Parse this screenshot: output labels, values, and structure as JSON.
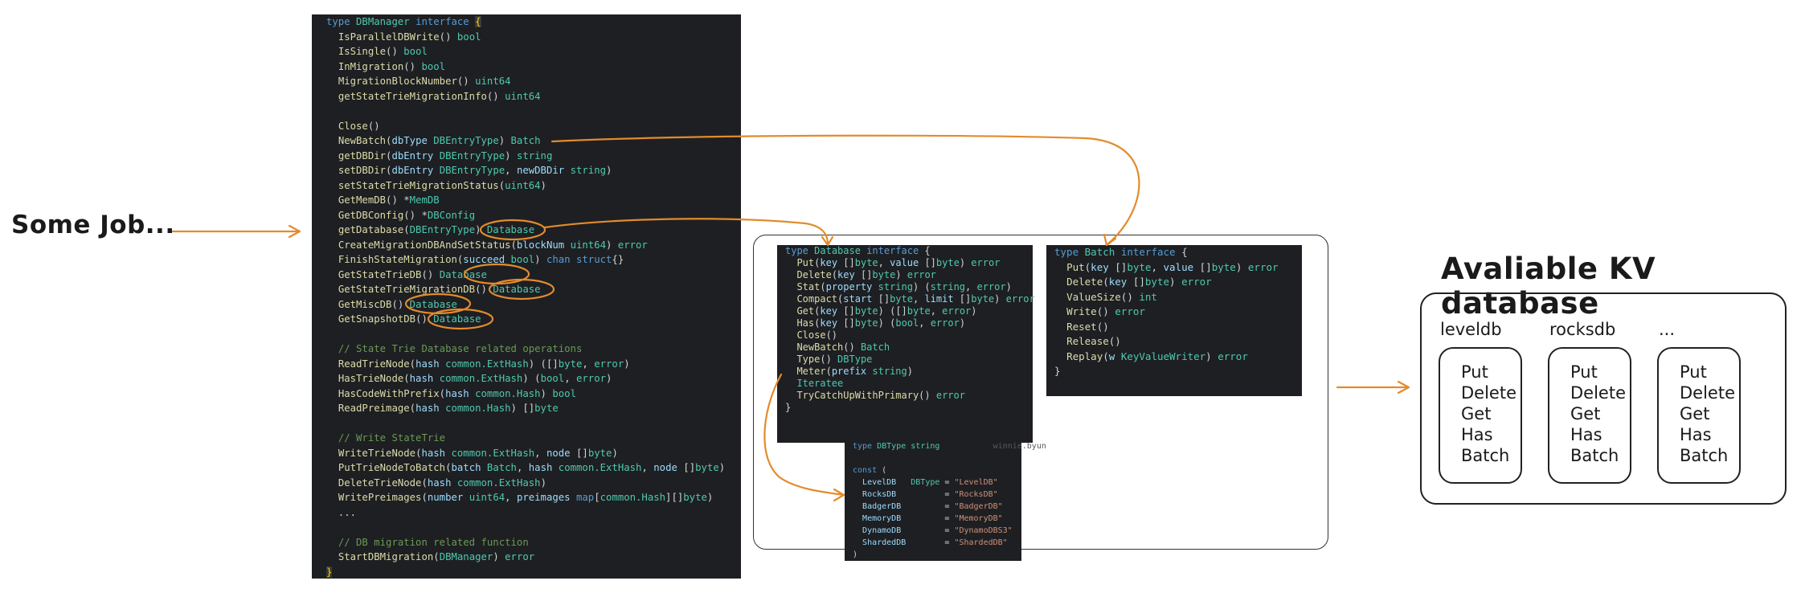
{
  "job_label": "Some Job...",
  "kv_title": "Avaliable KV database",
  "kv_columns": [
    {
      "name": "leveldb",
      "ops": [
        "Put",
        "Delete",
        "Get",
        "Has",
        "Batch"
      ]
    },
    {
      "name": "rocksdb",
      "ops": [
        "Put",
        "Delete",
        "Get",
        "Has",
        "Batch"
      ]
    },
    {
      "name": "...",
      "ops": [
        "Put",
        "Delete",
        "Get",
        "Has",
        "Batch"
      ]
    }
  ],
  "watermark": "winnie.byun",
  "arrow_color": "#e38b2c",
  "code_background": "#1e1f22"
}
